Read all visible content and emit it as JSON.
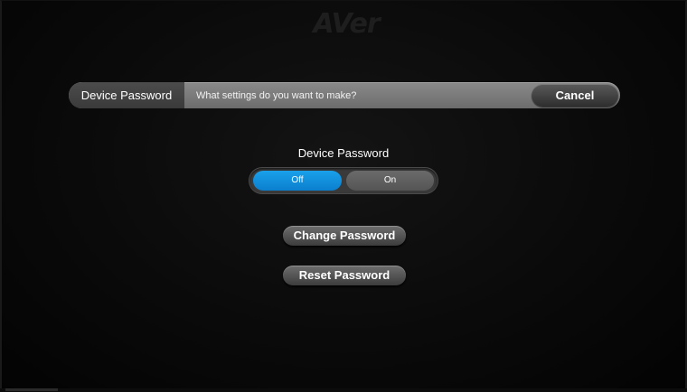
{
  "logo": {
    "text": "AVer"
  },
  "header": {
    "title": "Device Password",
    "prompt": "What settings do you want to make?",
    "cancel_label": "Cancel"
  },
  "device_password": {
    "label": "Device Password",
    "options": [
      {
        "label": "Off",
        "selected": true
      },
      {
        "label": "On",
        "selected": false
      }
    ]
  },
  "actions": {
    "change_password_label": "Change Password",
    "reset_password_label": "Reset Password"
  },
  "colors": {
    "accent": "#0b8fdc",
    "header_bar": "#7a7a7a",
    "background": "#0a0a0a"
  }
}
